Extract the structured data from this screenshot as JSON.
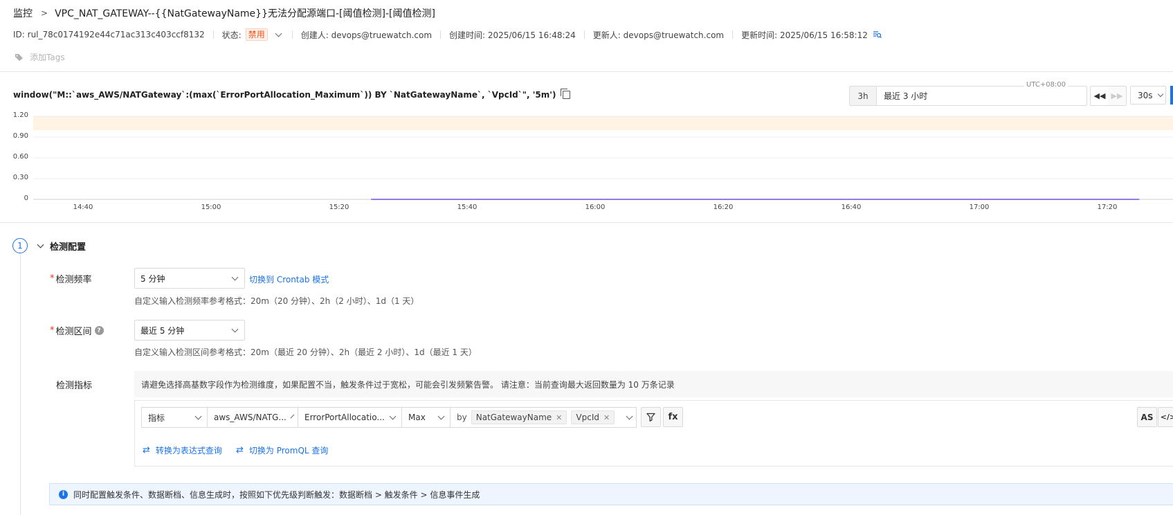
{
  "breadcrumb": {
    "parent": "监控",
    "separator": ">",
    "title": "VPC_NAT_GATEWAY--{{NatGatewayName}}无法分配源端口-[阈值检测]-[阈值检测]"
  },
  "meta": {
    "id": "ID: rul_78c0174192e44c71ac313c403ccf8132",
    "status_label": "状态:",
    "status_value": "禁用",
    "creator": "创建人: devops@truewatch.com",
    "created_time": "创建时间: 2025/06/15 16:48:24",
    "updater": "更新人: devops@truewatch.com",
    "updated_time": "更新时间: 2025/06/15 16:58:12"
  },
  "tags": {
    "placeholder": "添加Tags"
  },
  "query": {
    "text": "window(\"M::`aws_AWS/NATGateway`:(max(`ErrorPortAllocation_Maximum`)) BY `NatGatewayName`, `VpcId`\", '5m')"
  },
  "time_picker": {
    "timezone": "UTC+08:00",
    "quick": "3h",
    "range": "最近 3 小时",
    "refresh": "30s"
  },
  "chart_data": {
    "type": "line",
    "y_ticks": [
      "1.20",
      "0.90",
      "0.60",
      "0.30",
      "0"
    ],
    "ylim": [
      0,
      1.2
    ],
    "x_ticks": [
      "14:40",
      "15:00",
      "15:20",
      "15:40",
      "16:00",
      "16:20",
      "16:40",
      "17:00",
      "17:20"
    ],
    "threshold_band": [
      1.0,
      1.2
    ],
    "series": [
      {
        "x_start": "15:25",
        "x_end": "17:25",
        "values": [
          0,
          0
        ]
      }
    ],
    "colors": {
      "line": "#7b4ce0",
      "band": "#fff3e3"
    }
  },
  "config": {
    "step": "1",
    "title": "检测配置",
    "freq": {
      "label": "检测频率",
      "value": "5 分钟",
      "switch_link": "切换到 Crontab 模式",
      "hint": "自定义输入检测频率参考格式：20m（20 分钟）、2h（2 小时）、1d（1 天）"
    },
    "range": {
      "label": "检测区间",
      "value": "最近 5 分钟",
      "hint": "自定义输入检测区间参考格式：20m（最近 20 分钟）、2h（最近 2 小时）、1d（最近 1 天）"
    },
    "metric": {
      "label": "检测指标",
      "warning": "请避免选择高基数字段作为检测维度，如果配置不当，触发条件过于宽松，可能会引发频繁告警。 请注意：当前查询最大返回数量为 10 万条记录",
      "type": "指标",
      "measurement": "aws_AWS/NATG...",
      "field": "ErrorPortAllocatio...",
      "agg": "Max",
      "by": "by",
      "group_tags": [
        "NatGatewayName",
        "VpcId"
      ],
      "fx": "fx",
      "as": "AS",
      "code": "</>",
      "to_expression": "转换为表达式查询",
      "to_promql": "切换为 PromQL 查询"
    },
    "info": "同时配置触发条件、数据断档、信息生成时，按照如下优先级判断触发：数据断档 > 触发条件 > 信息事件生成"
  }
}
